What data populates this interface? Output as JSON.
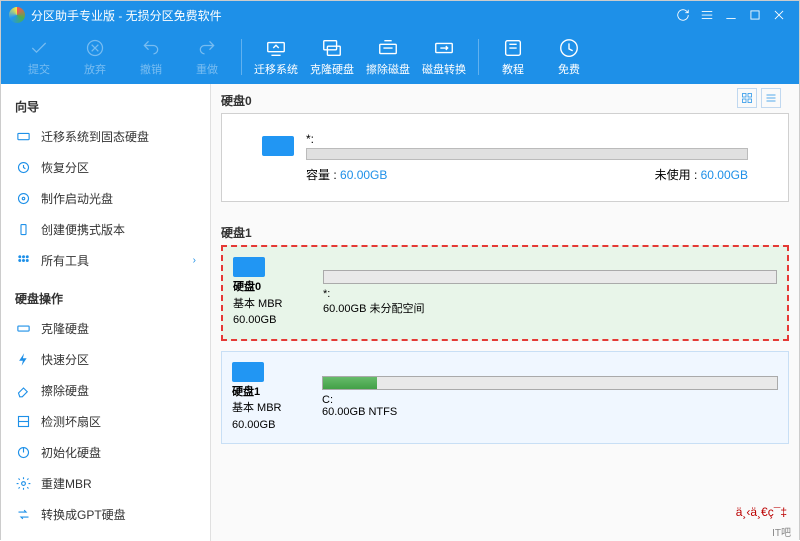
{
  "title": "分区助手专业版 - 无损分区免费软件",
  "toolbar": {
    "submit": "提交",
    "discard": "放弃",
    "undo": "撤销",
    "redo": "重做",
    "migrate": "迁移系统",
    "clone": "克隆硬盘",
    "wipe": "擦除磁盘",
    "convert": "磁盘转换",
    "tutorial": "教程",
    "free": "免费"
  },
  "sidebar": {
    "wizard_head": "向导",
    "wizard": [
      "迁移系统到固态硬盘",
      "恢复分区",
      "制作启动光盘",
      "创建便携式版本",
      "所有工具"
    ],
    "ops_head": "硬盘操作",
    "ops": [
      "克隆硬盘",
      "快速分区",
      "擦除硬盘",
      "检测坏扇区",
      "初始化硬盘",
      "重建MBR",
      "转换成GPT硬盘"
    ]
  },
  "main": {
    "disk0_label": "硬盘0",
    "disk1_label": "硬盘1",
    "summary": {
      "drive": "*:",
      "cap_label": "容量 :",
      "cap_val": "60.00GB",
      "free_label": "未使用 :",
      "free_val": "60.00GB"
    },
    "cards": [
      {
        "name": "硬盘0",
        "type": "基本 MBR",
        "size": "60.00GB",
        "part_label": "*:",
        "part_desc": "60.00GB 未分配空间",
        "fill_pct": 0,
        "selected": true
      },
      {
        "name": "硬盘1",
        "type": "基本 MBR",
        "size": "60.00GB",
        "part_label": "C:",
        "part_desc": "60.00GB NTFS",
        "fill_pct": 12,
        "selected": false
      }
    ]
  },
  "watermark": "IT吧",
  "footer_chars": "ä¸‹ä¸€ç¯‡"
}
